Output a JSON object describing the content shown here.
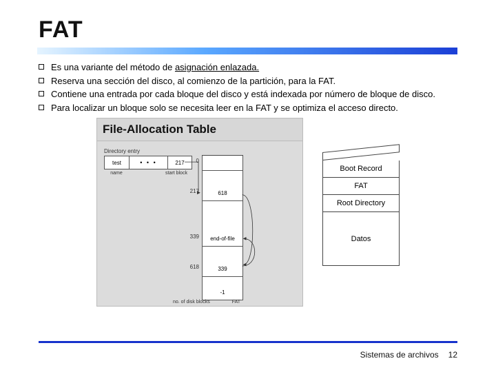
{
  "title": "FAT",
  "bullets": [
    {
      "pre": "Es una variante del método de ",
      "u": "asignación enlazada.",
      "post": ""
    },
    {
      "pre": "Reserva una sección del disco, al comienzo de la partición, para la FAT.",
      "u": "",
      "post": ""
    },
    {
      "pre": "Contiene una entrada por cada bloque del disco y está indexada por número de bloque de disco.",
      "u": "",
      "post": ""
    },
    {
      "pre": "Para localizar un bloque solo se necesita leer en la FAT y se optimiza el acceso directo.",
      "u": "",
      "post": ""
    }
  ],
  "diagram": {
    "title": "File-Allocation Table",
    "dir_label": "Directory entry",
    "dir_name": "test",
    "dir_dots": "• • •",
    "dir_start": "217",
    "sub_name": "name",
    "sub_start": "start block",
    "idx": {
      "i0": "0",
      "i217": "217",
      "i339": "339",
      "i618": "618"
    },
    "cell217": "618",
    "cell339": "end-of-file",
    "cell618": "339",
    "minus1": "-1",
    "footer_left": "no. of disk blocks",
    "footer_right": "FAT"
  },
  "stack": {
    "boot": "Boot Record",
    "fat": "FAT",
    "root": "Root Directory",
    "datos": "Datos"
  },
  "footer": {
    "label": "Sistemas de archivos",
    "page": "12"
  }
}
